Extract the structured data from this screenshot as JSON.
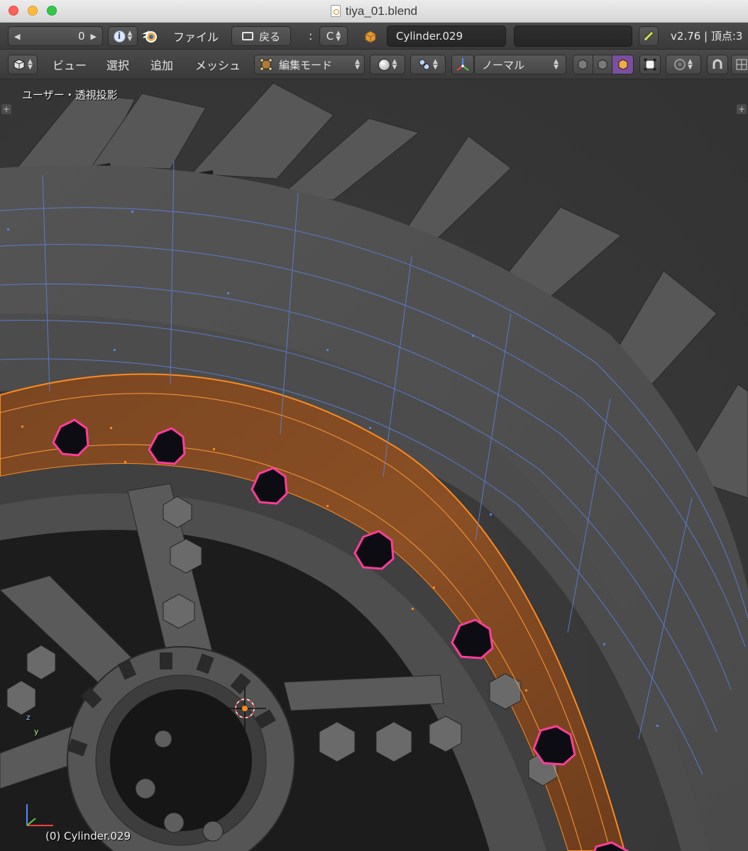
{
  "window": {
    "title": "tiya_01.blend"
  },
  "header1": {
    "frame_value": "0",
    "file_menu": "ファイル",
    "back_button": "戻る",
    "scene_separator": ":",
    "scene_letter": "C",
    "object_name": "Cylinder.029",
    "version_info": "v2.76 | 頂点:3"
  },
  "header2": {
    "menu_view": "ビュー",
    "menu_select": "選択",
    "menu_add": "追加",
    "menu_mesh": "メッシュ",
    "mode": "編集モード",
    "orientation": "ノーマル"
  },
  "viewport": {
    "view_label": "ユーザー・透視投影",
    "object_label": "(0) Cylinder.029",
    "axis_z": "z",
    "axis_y": "y",
    "colors": {
      "background": "#393939",
      "mesh": "#5d5d5d",
      "wire": "#5b7fd9",
      "selection": "#ff8a1f",
      "highlight": "#ff3d9a"
    }
  }
}
